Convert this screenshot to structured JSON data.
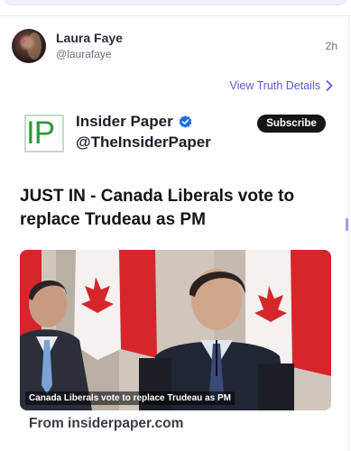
{
  "post": {
    "author_name": "Laura Faye",
    "author_handle": "@laurafaye",
    "timestamp": "2h",
    "truth_link_label": "View Truth Details"
  },
  "embed": {
    "logo_text": "IP",
    "source_name": "Insider Paper",
    "source_handle": "@TheInsiderPaper",
    "subscribe_label": "Subscribe",
    "headline": "JUST IN - Canada Liberals vote to replace Trudeau as PM",
    "image_caption": "Canada Liberals vote to replace Trudeau as PM",
    "from_line": "From insiderpaper.com"
  },
  "colors": {
    "link": "#5b5bd6",
    "verified": "#1d6fe3",
    "logo_green": "#2e9a3c",
    "subscribe_bg": "#151518"
  },
  "icons": {
    "truth_link": "chevron-right-icon",
    "verified": "verified-badge-icon"
  }
}
